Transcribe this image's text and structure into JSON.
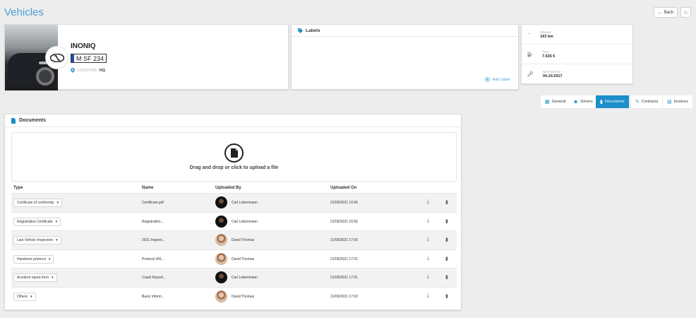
{
  "header": {
    "title": "Vehicles",
    "back_label": "Back"
  },
  "vehicle": {
    "name": "INONIQ",
    "plate": "M SF 234",
    "location_label": "LOCATION",
    "location_value": "HQ"
  },
  "labels_card": {
    "title": "Labels",
    "add_label": "Add Label"
  },
  "stats": [
    {
      "label": "Mileage",
      "value": "193 km",
      "icon": "speedometer-icon"
    },
    {
      "label": "TCO",
      "value": "7.635 €",
      "icon": "fuel-icon"
    },
    {
      "label": "Next Service",
      "value": "04.10.2017",
      "icon": "wrench-icon"
    }
  ],
  "tabs": [
    {
      "label": "General",
      "icon": "car-icon",
      "active": false
    },
    {
      "label": "Drivers",
      "icon": "users-icon",
      "active": false
    },
    {
      "label": "Documents",
      "icon": "document-icon",
      "active": true
    },
    {
      "label": "Contracts",
      "icon": "contract-icon",
      "active": false
    },
    {
      "label": "Invoices",
      "icon": "invoice-icon",
      "active": false
    }
  ],
  "documents": {
    "title": "Documents",
    "upload_text": "Drag and drop or click to upload a file",
    "columns": [
      "Type",
      "Name",
      "Uploaded By",
      "Uploaded On"
    ],
    "rows": [
      {
        "type": "Certificate of conformity",
        "name": "Certificate.pdf",
        "uploaded_by": "Carl Liebermann",
        "uploaded_on": "21/06/2021 16:56",
        "avatar": "dark"
      },
      {
        "type": "Registration Certificate",
        "name": "Registration...",
        "uploaded_by": "Carl Liebermann",
        "uploaded_on": "21/06/2021 16:56",
        "avatar": "dark"
      },
      {
        "type": "Last Vehicle Inspection",
        "name": "2021 Inspect...",
        "uploaded_by": "David Thomas",
        "uploaded_on": "21/06/2021 17:00",
        "avatar": "light"
      },
      {
        "type": "Handover protocol",
        "name": "Protocol 441...",
        "uploaded_by": "David Thomas",
        "uploaded_on": "21/06/2021 17:01",
        "avatar": "light"
      },
      {
        "type": "Accident report form",
        "name": "Crash Report...",
        "uploaded_by": "Carl Liebermann",
        "uploaded_on": "21/06/2021 17:01",
        "avatar": "dark"
      },
      {
        "type": "Others",
        "name": "Basic Inform...",
        "uploaded_by": "David Thomas",
        "uploaded_on": "21/06/2021 17:02",
        "avatar": "light"
      }
    ]
  },
  "colors": {
    "accent": "#1a8fc9",
    "title": "#4a9fd6",
    "background": "#eeedee"
  }
}
